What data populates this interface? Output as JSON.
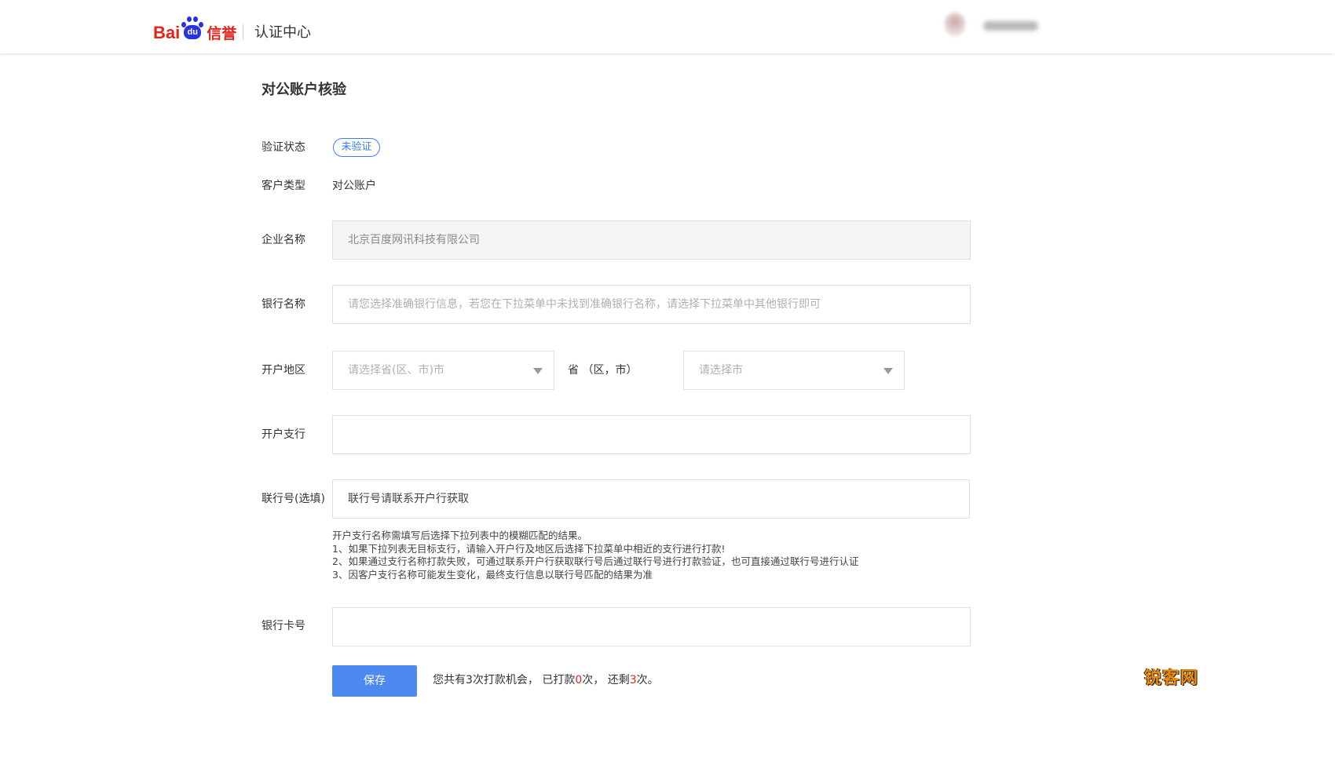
{
  "header": {
    "logo": {
      "part1": "Bai",
      "part2": "du",
      "part3": "信誉"
    },
    "site_name": "认证中心"
  },
  "page": {
    "title": "对公账户核验"
  },
  "form": {
    "status_label": "验证状态",
    "status_value": "未验证",
    "customer_type_label": "客户类型",
    "customer_type_value": "对公账户",
    "company_label": "企业名称",
    "company_value": "北京百度网讯科技有限公司",
    "bank_label": "银行名称",
    "bank_placeholder": "请您选择准确银行信息，若您在下拉菜单中未找到准确银行名称，请选择下拉菜单中其他银行即可",
    "region_label": "开户地区",
    "province_placeholder": "请选择省(区、市)市",
    "province_unit": "省 （区，市）",
    "city_placeholder": "请选择市",
    "branch_label": "开户支行",
    "branch_value": "",
    "union_no_label": "联行号(选填)",
    "union_no_value": "联行号请联系开户行获取",
    "help_lines": [
      "开户支行名称需填写后选择下拉列表中的模糊匹配的结果。",
      "1、如果下拉列表无目标支行，请输入开户行及地区后选择下拉菜单中相近的支行进行打款!",
      "2、如果通过支行名称打款失败，可通过联系开户行获取联行号后通过联行号进行打款验证，也可直接通过联行号进行认证",
      "3、因客户支行名称可能发生变化，最终支行信息以联行号匹配的结果为准"
    ],
    "card_label": "银行卡号",
    "card_value": "",
    "save_label": "保存",
    "chances": {
      "prefix": "您共有3次打款机会，  已打款",
      "used": "0",
      "mid": "次，  还剩",
      "remaining": "3",
      "suffix": "次。"
    }
  },
  "watermark": "锐客网",
  "colors": {
    "accent": "#4d8af0",
    "brand_red": "#e1251b",
    "brand_blue": "#2932e1",
    "status_blue": "#3d7cf0"
  }
}
